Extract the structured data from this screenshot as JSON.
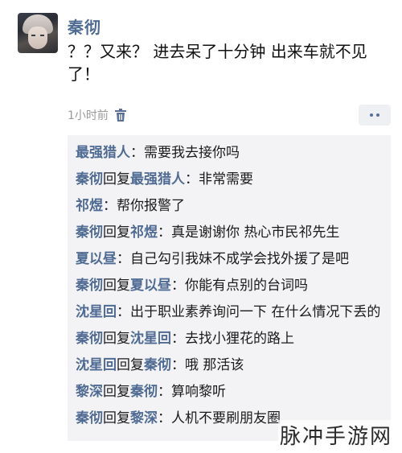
{
  "post": {
    "author": "秦彻",
    "text": "？？又来？ 进去呆了十分钟 出来车就不见了！",
    "time": "1小时前"
  },
  "icons": {
    "delete": "trash-icon",
    "more": "more-dots-icon"
  },
  "colors": {
    "name_link": "#4f6b93",
    "comment_bg": "#f3f3f5",
    "more_bg": "#eef0f4"
  },
  "reply_word": "回复",
  "comments": [
    {
      "from": "最强猎人",
      "to": "",
      "text": "：需要我去接你吗"
    },
    {
      "from": "秦彻",
      "to": "最强猎人",
      "text": "：非常需要"
    },
    {
      "from": "祁煜",
      "to": "",
      "text": "：帮你报警了"
    },
    {
      "from": "秦彻",
      "to": "祁煜",
      "text": "：真是谢谢你 热心市民祁先生"
    },
    {
      "from": "夏以昼",
      "to": "",
      "text": "：自己勾引我妹不成学会找外援了是吧"
    },
    {
      "from": "秦彻",
      "to": "夏以昼",
      "text": "：你能有点别的台词吗"
    },
    {
      "from": "沈星回",
      "to": "",
      "text": "：出于职业素养询问一下 在什么情况下丢的"
    },
    {
      "from": "秦彻",
      "to": "沈星回",
      "text": "：去找小狸花的路上"
    },
    {
      "from": "沈星回",
      "to": "秦彻",
      "text": "：哦 那活该"
    },
    {
      "from": "黎深",
      "to": "秦彻",
      "text": "：算响黎听"
    },
    {
      "from": "秦彻",
      "to": "黎深",
      "text": "：人机不要刷朋友圈"
    }
  ],
  "watermark": "脉冲手游网"
}
